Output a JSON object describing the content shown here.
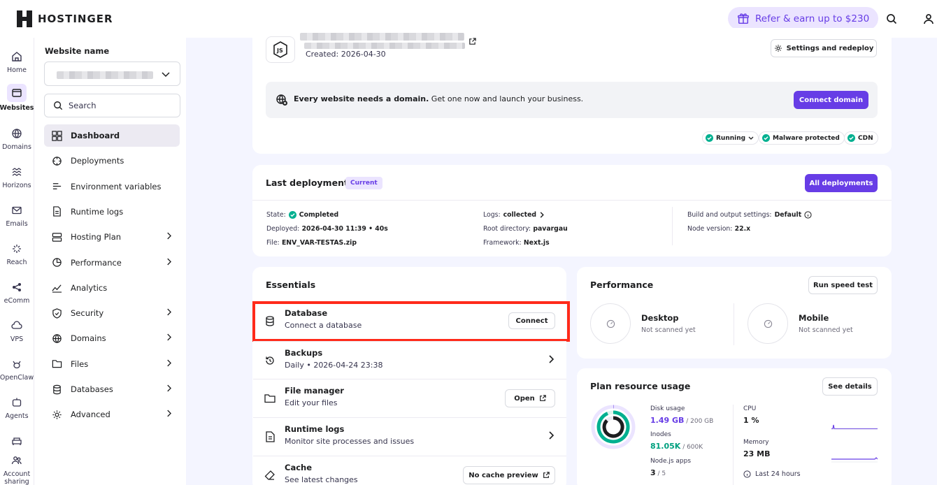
{
  "brand": {
    "name": "HOSTINGER"
  },
  "topbar": {
    "refer_label": "Refer & earn up to $230"
  },
  "rail": [
    {
      "label": "Home",
      "icon": "home-icon"
    },
    {
      "label": "Websites",
      "icon": "websites-icon",
      "active": true
    },
    {
      "label": "Domains",
      "icon": "globe-icon"
    },
    {
      "label": "Horizons",
      "icon": "horizons-icon"
    },
    {
      "label": "Emails",
      "icon": "mail-icon"
    },
    {
      "label": "Reach",
      "icon": "reach-icon"
    },
    {
      "label": "eComm",
      "icon": "share-icon"
    },
    {
      "label": "VPS",
      "icon": "cloud-icon"
    },
    {
      "label": "OpenClaw",
      "icon": "claw-icon"
    },
    {
      "label": "Agents",
      "icon": "agent-icon"
    },
    {
      "label": "",
      "icon": "sofa-icon"
    },
    {
      "label": "Account sharing",
      "icon": "people-icon"
    }
  ],
  "sidebar": {
    "title": "Website name",
    "search_placeholder": "Search",
    "items": [
      {
        "label": "Dashboard",
        "icon": "dashboard-icon",
        "active": true
      },
      {
        "label": "Deployments",
        "icon": "deployments-icon"
      },
      {
        "label": "Environment variables",
        "icon": "env-icon"
      },
      {
        "label": "Runtime logs",
        "icon": "logs-icon"
      },
      {
        "label": "Hosting Plan",
        "icon": "server-icon",
        "chevron": true
      },
      {
        "label": "Performance",
        "icon": "performance-icon",
        "chevron": true
      },
      {
        "label": "Analytics",
        "icon": "analytics-icon"
      },
      {
        "label": "Security",
        "icon": "shield-icon",
        "chevron": true
      },
      {
        "label": "Domains",
        "icon": "globe-icon",
        "chevron": true
      },
      {
        "label": "Files",
        "icon": "folder-icon",
        "chevron": true
      },
      {
        "label": "Databases",
        "icon": "database-icon",
        "chevron": true
      },
      {
        "label": "Advanced",
        "icon": "gear-icon",
        "chevron": true
      }
    ]
  },
  "site": {
    "created": "Created: 2026-04-30",
    "settings_label": "Settings and redeploy",
    "banner_bold": "Every website needs a domain.",
    "banner_rest": " Get one now and launch your business.",
    "connect_domain": "Connect domain",
    "status": {
      "running": "Running",
      "malware": "Malware protected",
      "cdn": "CDN"
    }
  },
  "deployment": {
    "title": "Last deployment",
    "badge": "Current",
    "all_label": "All deployments",
    "state_label": "State:",
    "state_value": "Completed",
    "deployed_label": "Deployed:",
    "deployed_value": "2026-04-30 11:39 • 40s",
    "file_label": "File:",
    "file_value": "ENV_VAR-TESTAS.zip",
    "logs_label": "Logs:",
    "logs_value": "collected",
    "root_label": "Root directory:",
    "root_value": "pavargau",
    "framework_label": "Framework:",
    "framework_value": "Next.js",
    "build_label": "Build and output settings:",
    "build_value": "Default",
    "node_label": "Node version:",
    "node_value": "22.x"
  },
  "essentials": {
    "title": "Essentials",
    "rows": [
      {
        "title": "Database",
        "sub": "Connect a database",
        "action": "Connect"
      },
      {
        "title": "Backups",
        "sub": "Daily • 2026-04-24 23:38"
      },
      {
        "title": "File manager",
        "sub": "Edit your files",
        "action": "Open"
      },
      {
        "title": "Runtime logs",
        "sub": "Monitor site processes and issues"
      },
      {
        "title": "Cache",
        "sub": "See latest changes",
        "action": "No cache preview"
      }
    ]
  },
  "performance": {
    "title": "Performance",
    "button": "Run speed test",
    "desktop_title": "Desktop",
    "desktop_sub": "Not scanned yet",
    "mobile_title": "Mobile",
    "mobile_sub": "Not scanned yet"
  },
  "usage": {
    "title": "Plan resource usage",
    "button": "See details",
    "disk_label": "Disk usage",
    "disk_value": "1.49 GB",
    "disk_total": " / 200 GB",
    "inodes_label": "Inodes",
    "inodes_value": "81.05K",
    "inodes_total": " / 600K",
    "node_label": "Node.js apps",
    "node_value": "3",
    "node_total": " / 5",
    "cpu_label": "CPU",
    "cpu_value": "1 %",
    "memory_label": "Memory",
    "memory_value": "23 MB",
    "period": "Last 24 hours"
  },
  "colors": {
    "accent": "#673de6",
    "success": "#00b090",
    "highlight": "#ff2a1a"
  }
}
